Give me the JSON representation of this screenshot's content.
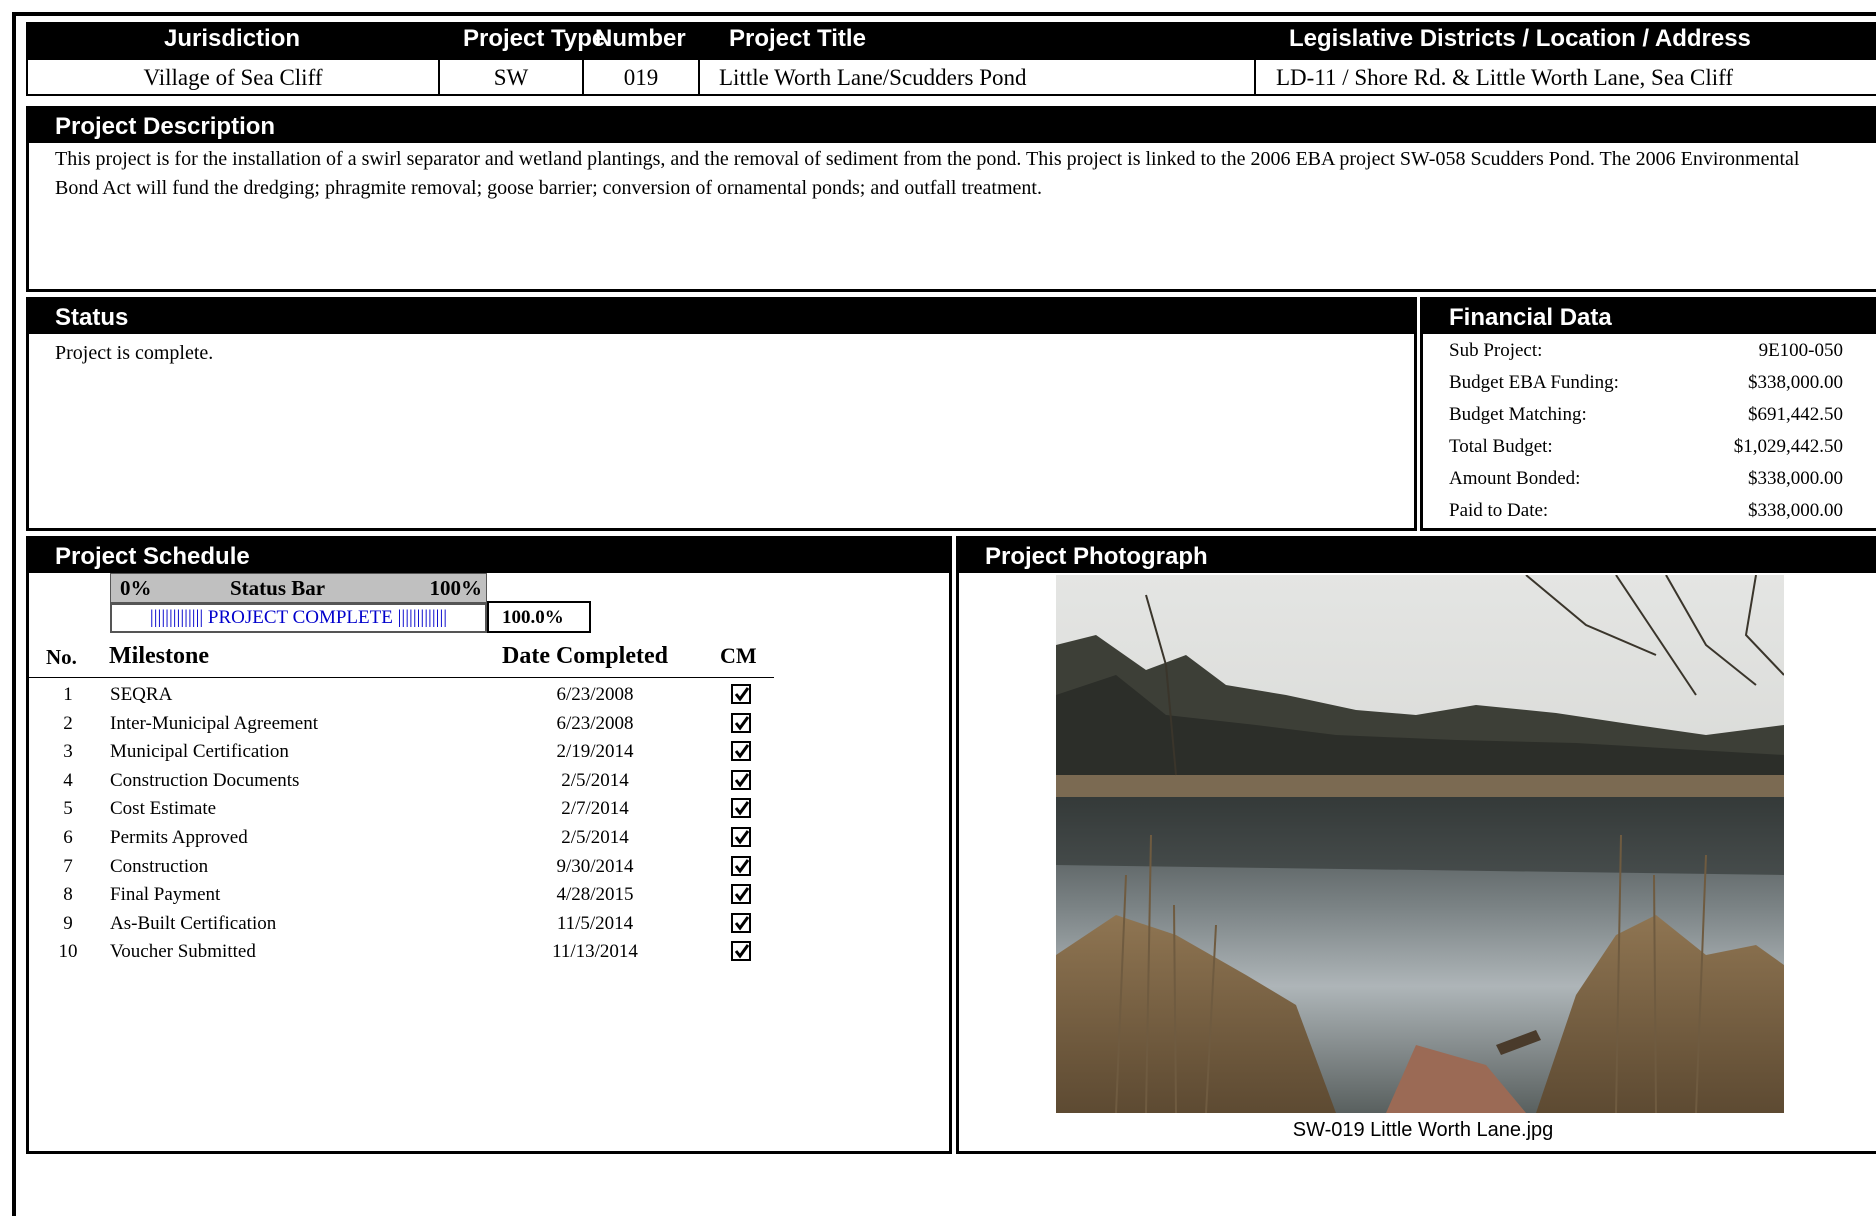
{
  "header": {
    "columns": [
      "Jurisdiction",
      "Project Type",
      "Number",
      "Project Title",
      "Legislative Districts / Location / Address"
    ],
    "values": [
      "Village of Sea Cliff",
      "SW",
      "019",
      "Little Worth Lane/Scudders Pond",
      "LD-11 / Shore Rd. & Little Worth Lane, Sea Cliff"
    ]
  },
  "description": {
    "title": "Project Description",
    "text": "This project is for the installation of a swirl separator and wetland plantings, and the removal of sediment from the pond. This project is linked to the 2006 EBA project SW-058 Scudders Pond. The 2006 Environmental Bond Act will fund the dredging; phragmite removal; goose barrier; conversion of ornamental ponds; and outfall treatment."
  },
  "status": {
    "title": "Status",
    "text": "Project is complete."
  },
  "financial": {
    "title": "Financial Data",
    "rows": [
      {
        "label": "Sub Project:",
        "value": "9E100-050"
      },
      {
        "label": "Budget EBA Funding:",
        "value": "$338,000.00"
      },
      {
        "label": "Budget Matching:",
        "value": "$691,442.50"
      },
      {
        "label": "Total Budget:",
        "value": "$1,029,442.50"
      },
      {
        "label": "Amount Bonded:",
        "value": "$338,000.00"
      },
      {
        "label": "Paid to Date:",
        "value": "$338,000.00"
      }
    ]
  },
  "schedule": {
    "title": "Project Schedule",
    "status_bar": {
      "min_label": "0%",
      "title": "Status Bar",
      "max_label": "100%",
      "bar_text": "|||||||||||||| PROJECT COMPLETE |||||||||||||",
      "percent_text": "100.0%",
      "progress": 1.0
    },
    "columns": {
      "no": "No.",
      "milestone": "Milestone",
      "date": "Date Completed",
      "cm": "CM"
    },
    "milestones": [
      {
        "no": "1",
        "name": "SEQRA",
        "date": "6/23/2008",
        "completed": true
      },
      {
        "no": "2",
        "name": "Inter-Municipal Agreement",
        "date": "6/23/2008",
        "completed": true
      },
      {
        "no": "3",
        "name": "Municipal Certification",
        "date": "2/19/2014",
        "completed": true
      },
      {
        "no": "4",
        "name": "Construction Documents",
        "date": "2/5/2014",
        "completed": true
      },
      {
        "no": "5",
        "name": "Cost Estimate",
        "date": "2/7/2014",
        "completed": true
      },
      {
        "no": "6",
        "name": "Permits Approved",
        "date": "2/5/2014",
        "completed": true
      },
      {
        "no": "7",
        "name": "Construction",
        "date": "9/30/2014",
        "completed": true
      },
      {
        "no": "8",
        "name": "Final Payment",
        "date": "4/28/2015",
        "completed": true
      },
      {
        "no": "9",
        "name": "As-Built Certification",
        "date": "11/5/2014",
        "completed": true
      },
      {
        "no": "10",
        "name": "Voucher Submitted",
        "date": "11/13/2014",
        "completed": true
      }
    ]
  },
  "photograph": {
    "title": "Project Photograph",
    "caption": "SW-019 Little Worth Lane.jpg"
  }
}
